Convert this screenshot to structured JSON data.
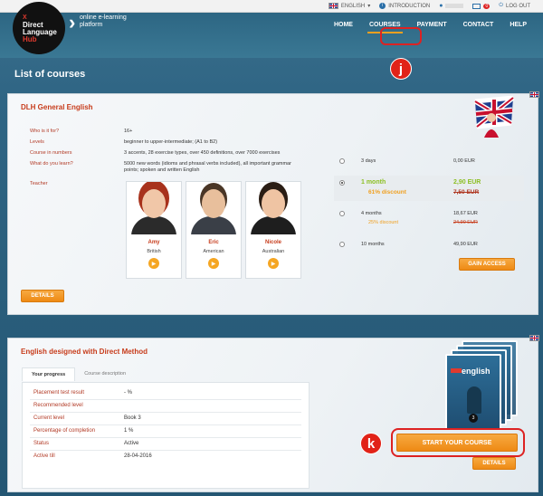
{
  "topbar": {
    "language": "ENGLISH",
    "introduction": "INTRODUCTION",
    "mail_count": "0",
    "logout": "LOG OUT"
  },
  "logo": {
    "mark": "X",
    "line1": "Direct",
    "line2": "Language",
    "line3": "Hub"
  },
  "tagline": {
    "line1": "online e-learning",
    "line2": "platform"
  },
  "nav": {
    "home": "HOME",
    "courses": "COURSES",
    "payment": "PAYMENT",
    "contact": "CONTACT",
    "help": "HELP"
  },
  "markers": {
    "j": "j",
    "k": "k"
  },
  "page_title": "List of courses",
  "course1": {
    "title": "DLH General English",
    "rows": [
      {
        "key": "Who is it for?",
        "value": "16+"
      },
      {
        "key": "Levels",
        "value": "beginner to upper-intermediate; (A1 to B2)"
      },
      {
        "key": "Course in numbers",
        "value": "3 accents, 28 exercise types, over 450 definitions, over 7000 exercises"
      },
      {
        "key": "What do you learn?",
        "value": "5000 new words (idioms and phrasal verbs included), all important grammar points; spoken and written English"
      },
      {
        "key": "Teacher",
        "value": ""
      }
    ],
    "teachers": [
      {
        "name": "Amy",
        "accent": "British"
      },
      {
        "name": "Eric",
        "accent": "American"
      },
      {
        "name": "Nicole",
        "accent": "Australian"
      }
    ],
    "options": [
      {
        "name": "3 days",
        "price": "0,00 EUR",
        "discount": "",
        "old": "",
        "selected": false
      },
      {
        "name": "1 month",
        "price": "2,90 EUR",
        "discount": "61% discount",
        "old": "7,50 EUR",
        "selected": true
      },
      {
        "name": "4 months",
        "price": "18,67 EUR",
        "discount": "25% discount",
        "old": "24,90 EUR",
        "selected": false
      },
      {
        "name": "10 months",
        "price": "49,90 EUR",
        "discount": "",
        "old": "",
        "selected": false
      }
    ],
    "gain_access": "GAIN ACCESS",
    "details": "DETAILS"
  },
  "course2": {
    "title": "English designed with Direct Method",
    "tab_progress": "Your progress",
    "tab_description": "Course description",
    "rows": [
      {
        "key": "Placement test result",
        "value": "- %"
      },
      {
        "key": "Recommended level",
        "value": ""
      },
      {
        "key": "Current level",
        "value": "Book 3"
      },
      {
        "key": "Percentage of completion",
        "value": "1 %"
      },
      {
        "key": "Status",
        "value": "Active"
      },
      {
        "key": "Active till",
        "value": "28-04-2016"
      }
    ],
    "book_title": "english",
    "book_badge": "3",
    "start": "START YOUR COURSE",
    "details": "DETAILS"
  },
  "colors": {
    "accent_orange": "#F0A020",
    "title_red": "#C73C1B",
    "price_green": "#8CBF24",
    "marker_red": "#E12318",
    "background_blue": "#2F6584"
  }
}
